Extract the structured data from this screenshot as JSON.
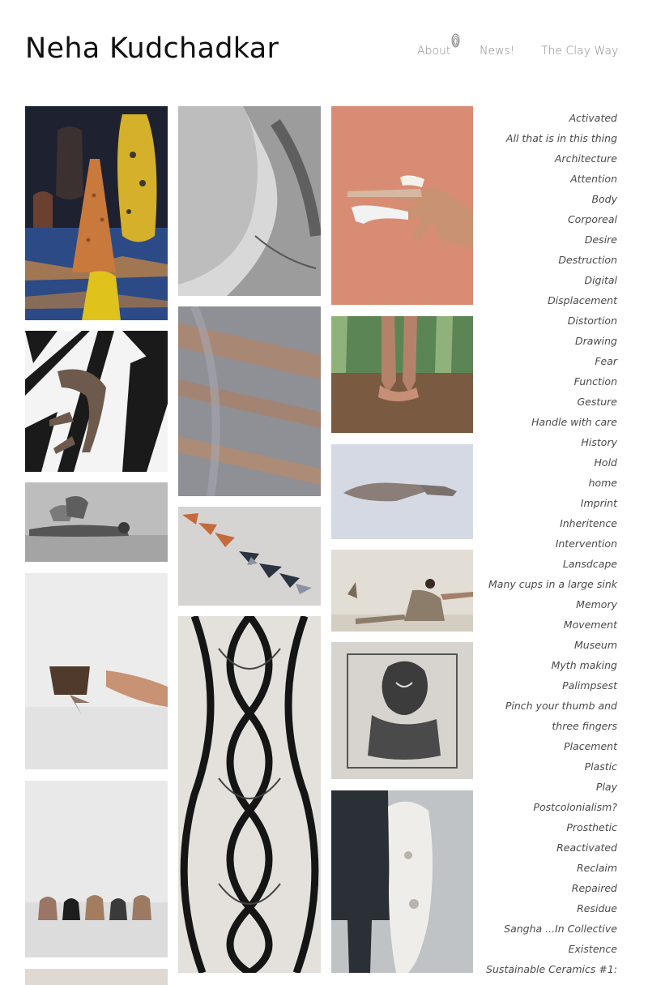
{
  "site": {
    "title": "Neha Kudchadkar"
  },
  "nav": {
    "items": [
      "About",
      "News!",
      "The Clay Way"
    ]
  },
  "tags": [
    "Activated",
    "All that is in this thing",
    "Architecture",
    "Attention",
    "Body",
    "Corporeal",
    "Desire",
    "Destruction",
    "Digital",
    "Displacement",
    "Distortion",
    "Drawing",
    "Fear",
    "Function",
    "Gesture",
    "Handle with care",
    "History",
    "Hold",
    "home",
    "Imprint",
    "Inheritence",
    "Intervention",
    "Lansdcape",
    "Many cups in a large sink",
    "Memory",
    "Movement",
    "Museum",
    "Myth making",
    "Palimpsest",
    "Pinch your thumb and",
    "three fingers",
    "Placement",
    "Plastic",
    "Play",
    "Postcolonialism?",
    "Prosthetic",
    "Reactivated",
    "Reclaim",
    "Repaired",
    "Residue",
    "Sangha ...In Collective",
    "Existence",
    "Sustainable Ceramics #1:"
  ],
  "colors": {
    "title": "#111111",
    "nav_text": "#8a8a8a",
    "tag_text": "#4a4a4a",
    "salmon_background": "#d98c74"
  }
}
